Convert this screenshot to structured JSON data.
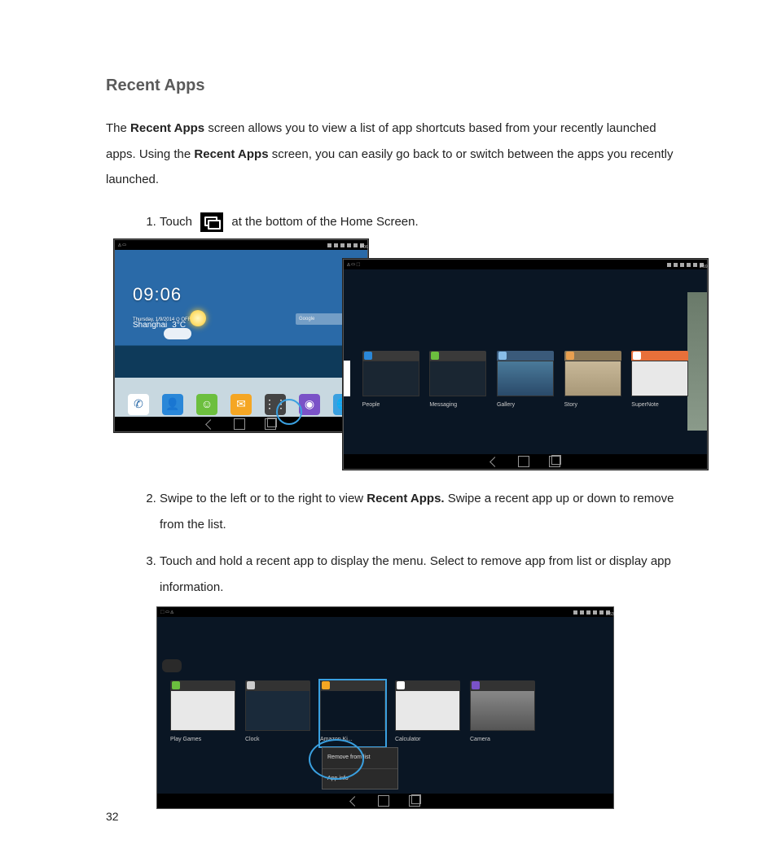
{
  "title": "Recent Apps",
  "intro": {
    "p1a": "The ",
    "p1b": "Recent Apps",
    "p1c": " screen allows you to view a list of app shortcuts based from your recently launched apps. Using the ",
    "p1d": "Recent Apps",
    "p1e": " screen, you can easily go back to or switch between the apps you recently launched."
  },
  "steps": {
    "s1a": "Touch ",
    "s1b": " at the bottom of the Home Screen.",
    "s2a": "Swipe to the left or to the right to view ",
    "s2b": "Recent Apps.",
    "s2c": " Swipe a recent app up or down to remove from the list.",
    "s3": "Touch and hold a recent app to display the menu. Select to remove app from list or display app information."
  },
  "shot1": {
    "time": "09:06",
    "date": "Thursday, 1/9/2014 ⏻ OFF",
    "city": "Shanghai",
    "temp": "3°C",
    "google": "Google",
    "status_time": "9:06",
    "dock": [
      "Phone",
      "People",
      "Messaging",
      "Email",
      "",
      "Camera",
      "Browser"
    ]
  },
  "shot2": {
    "status_time": "2:59",
    "cards": [
      "People",
      "Messaging",
      "Gallery",
      "Story",
      "SuperNote"
    ]
  },
  "shot3": {
    "status_time": "3:53",
    "cards": [
      "Play Games",
      "Clock",
      "Amazon Ki...",
      "Calculator",
      "Camera"
    ],
    "menu": [
      "Remove from list",
      "App info"
    ]
  },
  "page_number": "32"
}
